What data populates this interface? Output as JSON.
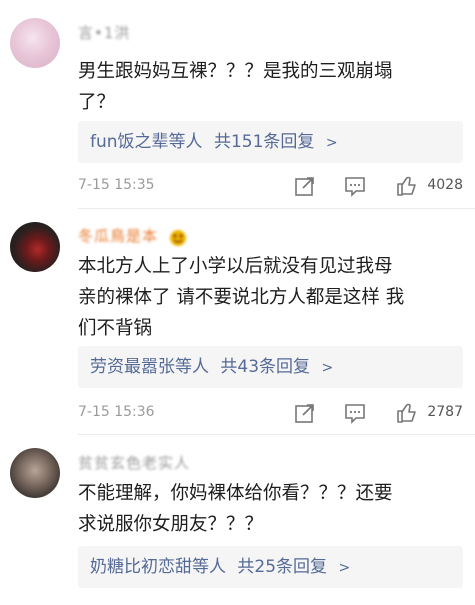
{
  "comments": [
    {
      "username": "言•1洪",
      "text_lines": [
        "男生跟妈妈互裸？？？是我的三观崩塌",
        "了？"
      ],
      "reply_names": "fun饭之辈",
      "reply_suffix": "等人",
      "reply_count": "共151条回复",
      "chevron": ">",
      "time": "7-15 15:35",
      "likes": "4028"
    },
    {
      "username": "冬瓜鳥是本",
      "text_lines": [
        "本北方人上了小学以后就没有见过我母",
        "亲的裸体了 请不要说北方人都是这样 我",
        "们不背锅"
      ],
      "reply_names": "劳资最嚣张",
      "reply_suffix": "等人",
      "reply_count": "共43条回复",
      "chevron": ">",
      "time": "7-15 15:36",
      "likes": "2787"
    },
    {
      "username": "贫贫玄色老实人",
      "text_lines": [
        "不能理解，你妈裸体给你看？？？还要",
        "求说服你女朋友？？？"
      ],
      "reply_names": "奶糖比初恋甜",
      "reply_suffix": "等人",
      "reply_count": "共25条回复",
      "chevron": ">"
    }
  ],
  "icons": {
    "share": "share-icon",
    "comment": "comment-icon",
    "like": "thumbs-up-icon"
  },
  "colors": {
    "link_blue": "#556a97",
    "username_orange": "#e8792b",
    "timestamp_gray": "#9b9b9b"
  }
}
